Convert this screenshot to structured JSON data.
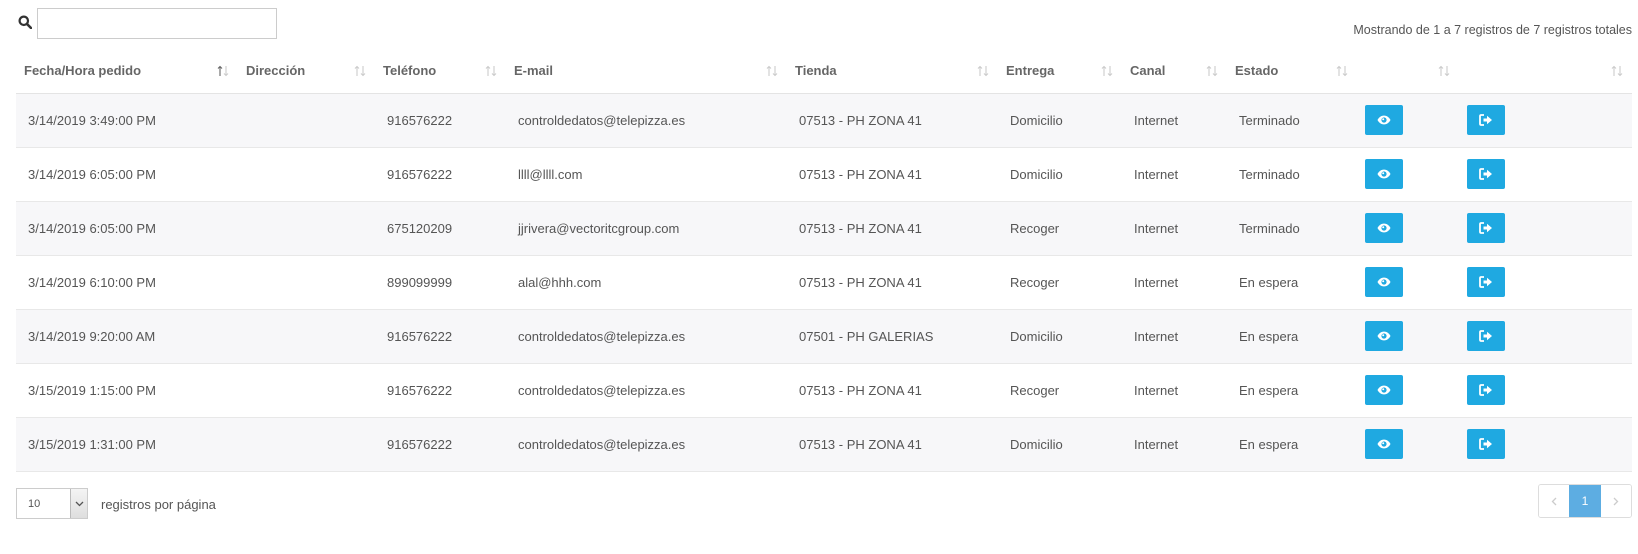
{
  "search": {
    "placeholder": "",
    "value": ""
  },
  "info": "Mostrando de 1 a 7 registros de 7 registros totales",
  "columns": [
    "Fecha/Hora pedido",
    "Dirección",
    "Teléfono",
    "E-mail",
    "Tienda",
    "Entrega",
    "Canal",
    "Estado",
    "",
    ""
  ],
  "rows": [
    {
      "fecha": "3/14/2019 3:49:00 PM",
      "direccion": "",
      "telefono": "916576222",
      "email": "controldedatos@telepizza.es",
      "tienda": "07513 - PH ZONA 41",
      "entrega": "Domicilio",
      "canal": "Internet",
      "estado": "Terminado"
    },
    {
      "fecha": "3/14/2019 6:05:00 PM",
      "direccion": "",
      "telefono": "916576222",
      "email": "llll@llll.com",
      "tienda": "07513 - PH ZONA 41",
      "entrega": "Domicilio",
      "canal": "Internet",
      "estado": "Terminado"
    },
    {
      "fecha": "3/14/2019 6:05:00 PM",
      "direccion": "",
      "telefono": "675120209",
      "email": "jjrivera@vectoritcgroup.com",
      "tienda": "07513 - PH ZONA 41",
      "entrega": "Recoger",
      "canal": "Internet",
      "estado": "Terminado"
    },
    {
      "fecha": "3/14/2019 6:10:00 PM",
      "direccion": "",
      "telefono": "899099999",
      "email": "alal@hhh.com",
      "tienda": "07513 - PH ZONA 41",
      "entrega": "Recoger",
      "canal": "Internet",
      "estado": "En espera"
    },
    {
      "fecha": "3/14/2019 9:20:00 AM",
      "direccion": "",
      "telefono": "916576222",
      "email": "controldedatos@telepizza.es",
      "tienda": "07501 - PH GALERIAS",
      "entrega": "Domicilio",
      "canal": "Internet",
      "estado": "En espera"
    },
    {
      "fecha": "3/15/2019 1:15:00 PM",
      "direccion": "",
      "telefono": "916576222",
      "email": "controldedatos@telepizza.es",
      "tienda": "07513 - PH ZONA 41",
      "entrega": "Recoger",
      "canal": "Internet",
      "estado": "En espera"
    },
    {
      "fecha": "3/15/2019 1:31:00 PM",
      "direccion": "",
      "telefono": "916576222",
      "email": "controldedatos@telepizza.es",
      "tienda": "07513 - PH ZONA 41",
      "entrega": "Domicilio",
      "canal": "Internet",
      "estado": "En espera"
    }
  ],
  "actions": {
    "view_icon": "eye-icon",
    "open_icon": "sign-out-icon",
    "button_color": "#1fa9e1"
  },
  "footer": {
    "page_size": "10",
    "page_size_label": "registros por página",
    "current_page": "1",
    "prev_icon": "chevron-left-icon",
    "next_icon": "chevron-right-icon",
    "active_color": "#5dade2"
  }
}
